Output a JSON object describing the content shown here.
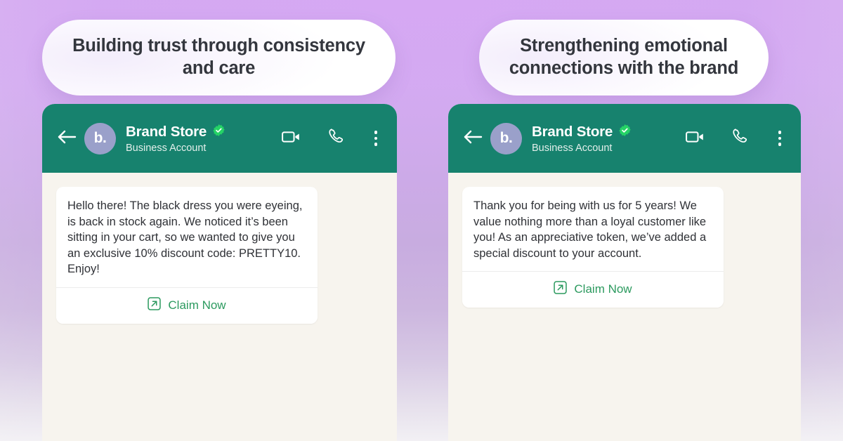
{
  "theme": {
    "background_top": "#d3a9f0",
    "background_bottom": "#f2f0f4",
    "header_green": "#17826e",
    "chat_bg": "#f7f4ee",
    "bubble_bg": "#ffffff",
    "link_green": "#2c9a5f",
    "verified_green": "#25d366",
    "avatar_bg": "#9aa0ca",
    "caption_text": "#33363d"
  },
  "panels": [
    {
      "caption": "Building trust through consistency and care",
      "header": {
        "back_icon": "arrow-left-icon",
        "avatar_initials": "b.",
        "contact_name": "Brand Store",
        "verified_icon": "verified-badge-icon",
        "subtitle": "Business Account",
        "video_icon": "video-camera-icon",
        "call_icon": "phone-call-icon",
        "menu_icon": "more-vertical-icon"
      },
      "message": {
        "body": "Hello there! The black dress you were eyeing, is back in stock again. We noticed it’s been sitting in your cart, so we wanted to give you an exclusive 10% discount code: PRETTY10. Enjoy!",
        "cta_label": "Claim Now",
        "cta_icon": "external-link-icon"
      }
    },
    {
      "caption": "Strengthening emotional connections with the brand",
      "header": {
        "back_icon": "arrow-left-icon",
        "avatar_initials": "b.",
        "contact_name": "Brand Store",
        "verified_icon": "verified-badge-icon",
        "subtitle": "Business Account",
        "video_icon": "video-camera-icon",
        "call_icon": "phone-call-icon",
        "menu_icon": "more-vertical-icon"
      },
      "message": {
        "body": "Thank you for being with us for 5 years! We value nothing more than a loyal customer like you! As an appreciative token, we’ve added a special discount to your account.",
        "cta_label": "Claim Now",
        "cta_icon": "external-link-icon"
      }
    }
  ]
}
